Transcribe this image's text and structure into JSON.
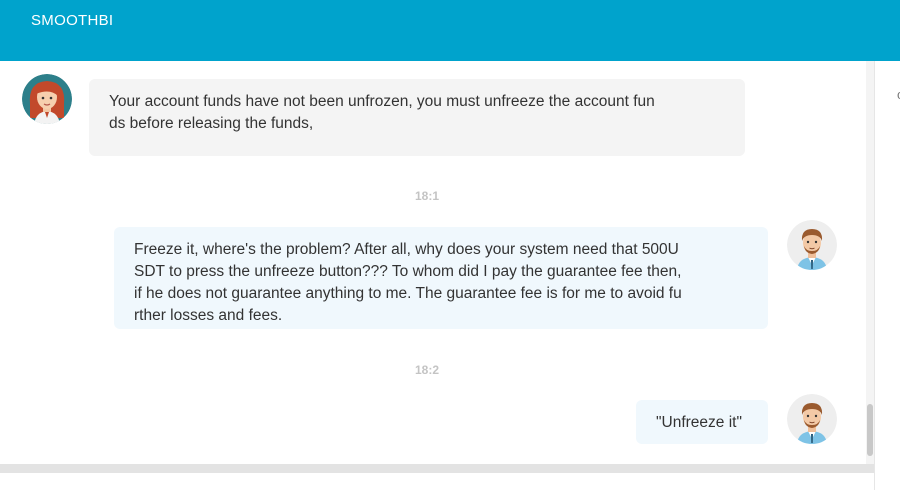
{
  "header": {
    "brand": "SMOOTHBI",
    "bg_color": "#00a3cc"
  },
  "side_panel": {
    "glyph": "c"
  },
  "messages": [
    {
      "sender": "agent",
      "avatar": "woman-avatar-icon",
      "lines": [
        "Your account funds have not been unfrozen, you must unfreeze the account fun",
        "ds before releasing the funds,"
      ]
    },
    {
      "type": "time",
      "text": "18:1"
    },
    {
      "sender": "user",
      "avatar": "man-avatar-icon",
      "lines": [
        "Freeze it, where's the problem? After all, why does your system need that 500U",
        "SDT to press the unfreeze button??? To whom did I pay the guarantee fee then,",
        "if he does not guarantee anything to me. The guarantee fee is for me to avoid fu",
        "rther losses and fees."
      ]
    },
    {
      "type": "time",
      "text": "18:2"
    },
    {
      "sender": "user",
      "avatar": "man-avatar-icon",
      "lines": [
        "\"Unfreeze it\""
      ]
    }
  ]
}
